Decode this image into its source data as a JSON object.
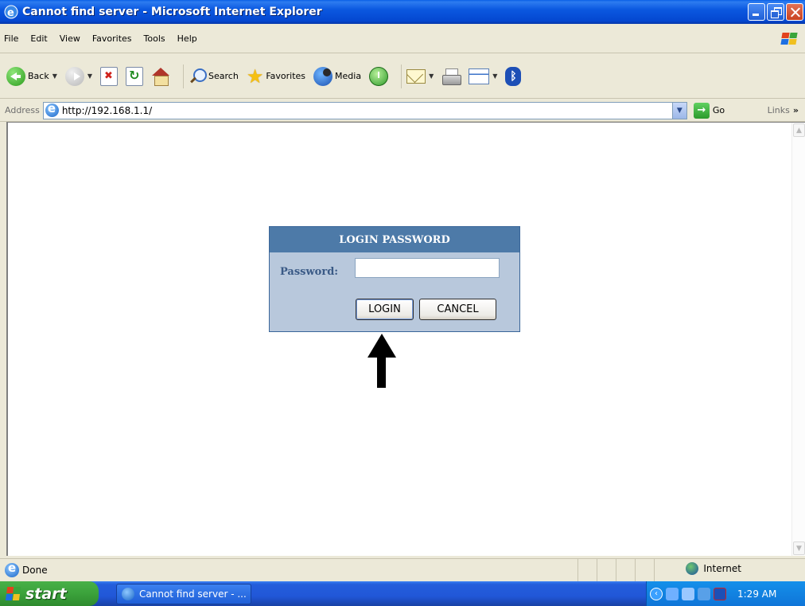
{
  "window": {
    "title": "Cannot find server - Microsoft Internet Explorer"
  },
  "menubar": {
    "items": [
      "File",
      "Edit",
      "View",
      "Favorites",
      "Tools",
      "Help"
    ]
  },
  "toolbar": {
    "back_label": "Back",
    "search_label": "Search",
    "favorites_label": "Favorites",
    "media_label": "Media"
  },
  "addressbar": {
    "label": "Address",
    "url": "http://192.168.1.1/",
    "go_label": "Go",
    "links_label": "Links"
  },
  "login": {
    "header": "LOGIN PASSWORD",
    "password_label": "Password:",
    "password_value": "",
    "login_button": "LOGIN",
    "cancel_button": "CANCEL"
  },
  "statusbar": {
    "status": "Done",
    "zone": "Internet"
  },
  "taskbar": {
    "start_label": "start",
    "task_label": "Cannot find server - ...",
    "clock": "1:29 AM"
  },
  "colors": {
    "login_header": "#4d7aa8",
    "login_body": "#b8c8dc",
    "title_bar": "#0b58e0",
    "start_button": "#3ba23b"
  }
}
